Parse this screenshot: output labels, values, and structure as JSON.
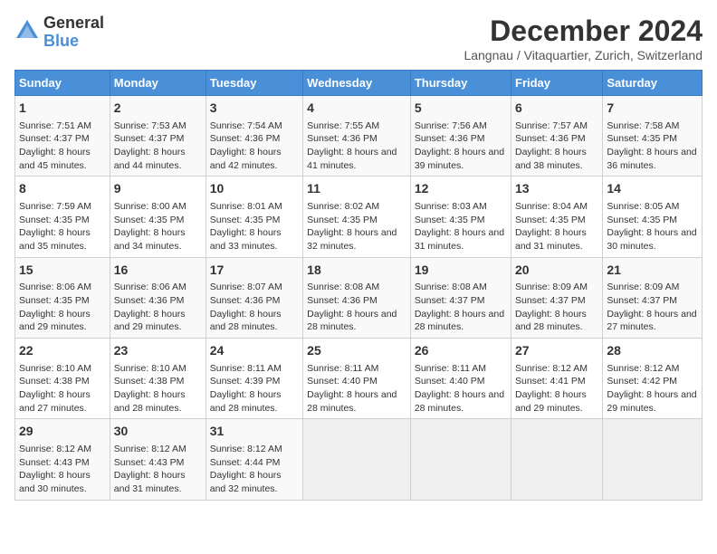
{
  "logo": {
    "general": "General",
    "blue": "Blue"
  },
  "title": "December 2024",
  "subtitle": "Langnau / Vitaquartier, Zurich, Switzerland",
  "days_of_week": [
    "Sunday",
    "Monday",
    "Tuesday",
    "Wednesday",
    "Thursday",
    "Friday",
    "Saturday"
  ],
  "weeks": [
    [
      {
        "day": "1",
        "sunrise": "7:51 AM",
        "sunset": "4:37 PM",
        "daylight": "8 hours and 45 minutes."
      },
      {
        "day": "2",
        "sunrise": "7:53 AM",
        "sunset": "4:37 PM",
        "daylight": "8 hours and 44 minutes."
      },
      {
        "day": "3",
        "sunrise": "7:54 AM",
        "sunset": "4:36 PM",
        "daylight": "8 hours and 42 minutes."
      },
      {
        "day": "4",
        "sunrise": "7:55 AM",
        "sunset": "4:36 PM",
        "daylight": "8 hours and 41 minutes."
      },
      {
        "day": "5",
        "sunrise": "7:56 AM",
        "sunset": "4:36 PM",
        "daylight": "8 hours and 39 minutes."
      },
      {
        "day": "6",
        "sunrise": "7:57 AM",
        "sunset": "4:36 PM",
        "daylight": "8 hours and 38 minutes."
      },
      {
        "day": "7",
        "sunrise": "7:58 AM",
        "sunset": "4:35 PM",
        "daylight": "8 hours and 36 minutes."
      }
    ],
    [
      {
        "day": "8",
        "sunrise": "7:59 AM",
        "sunset": "4:35 PM",
        "daylight": "8 hours and 35 minutes."
      },
      {
        "day": "9",
        "sunrise": "8:00 AM",
        "sunset": "4:35 PM",
        "daylight": "8 hours and 34 minutes."
      },
      {
        "day": "10",
        "sunrise": "8:01 AM",
        "sunset": "4:35 PM",
        "daylight": "8 hours and 33 minutes."
      },
      {
        "day": "11",
        "sunrise": "8:02 AM",
        "sunset": "4:35 PM",
        "daylight": "8 hours and 32 minutes."
      },
      {
        "day": "12",
        "sunrise": "8:03 AM",
        "sunset": "4:35 PM",
        "daylight": "8 hours and 31 minutes."
      },
      {
        "day": "13",
        "sunrise": "8:04 AM",
        "sunset": "4:35 PM",
        "daylight": "8 hours and 31 minutes."
      },
      {
        "day": "14",
        "sunrise": "8:05 AM",
        "sunset": "4:35 PM",
        "daylight": "8 hours and 30 minutes."
      }
    ],
    [
      {
        "day": "15",
        "sunrise": "8:06 AM",
        "sunset": "4:35 PM",
        "daylight": "8 hours and 29 minutes."
      },
      {
        "day": "16",
        "sunrise": "8:06 AM",
        "sunset": "4:36 PM",
        "daylight": "8 hours and 29 minutes."
      },
      {
        "day": "17",
        "sunrise": "8:07 AM",
        "sunset": "4:36 PM",
        "daylight": "8 hours and 28 minutes."
      },
      {
        "day": "18",
        "sunrise": "8:08 AM",
        "sunset": "4:36 PM",
        "daylight": "8 hours and 28 minutes."
      },
      {
        "day": "19",
        "sunrise": "8:08 AM",
        "sunset": "4:37 PM",
        "daylight": "8 hours and 28 minutes."
      },
      {
        "day": "20",
        "sunrise": "8:09 AM",
        "sunset": "4:37 PM",
        "daylight": "8 hours and 28 minutes."
      },
      {
        "day": "21",
        "sunrise": "8:09 AM",
        "sunset": "4:37 PM",
        "daylight": "8 hours and 27 minutes."
      }
    ],
    [
      {
        "day": "22",
        "sunrise": "8:10 AM",
        "sunset": "4:38 PM",
        "daylight": "8 hours and 27 minutes."
      },
      {
        "day": "23",
        "sunrise": "8:10 AM",
        "sunset": "4:38 PM",
        "daylight": "8 hours and 28 minutes."
      },
      {
        "day": "24",
        "sunrise": "8:11 AM",
        "sunset": "4:39 PM",
        "daylight": "8 hours and 28 minutes."
      },
      {
        "day": "25",
        "sunrise": "8:11 AM",
        "sunset": "4:40 PM",
        "daylight": "8 hours and 28 minutes."
      },
      {
        "day": "26",
        "sunrise": "8:11 AM",
        "sunset": "4:40 PM",
        "daylight": "8 hours and 28 minutes."
      },
      {
        "day": "27",
        "sunrise": "8:12 AM",
        "sunset": "4:41 PM",
        "daylight": "8 hours and 29 minutes."
      },
      {
        "day": "28",
        "sunrise": "8:12 AM",
        "sunset": "4:42 PM",
        "daylight": "8 hours and 29 minutes."
      }
    ],
    [
      {
        "day": "29",
        "sunrise": "8:12 AM",
        "sunset": "4:43 PM",
        "daylight": "8 hours and 30 minutes."
      },
      {
        "day": "30",
        "sunrise": "8:12 AM",
        "sunset": "4:43 PM",
        "daylight": "8 hours and 31 minutes."
      },
      {
        "day": "31",
        "sunrise": "8:12 AM",
        "sunset": "4:44 PM",
        "daylight": "8 hours and 32 minutes."
      },
      null,
      null,
      null,
      null
    ]
  ],
  "labels": {
    "sunrise": "Sunrise:",
    "sunset": "Sunset:",
    "daylight": "Daylight:"
  },
  "accent_color": "#4a90d9"
}
